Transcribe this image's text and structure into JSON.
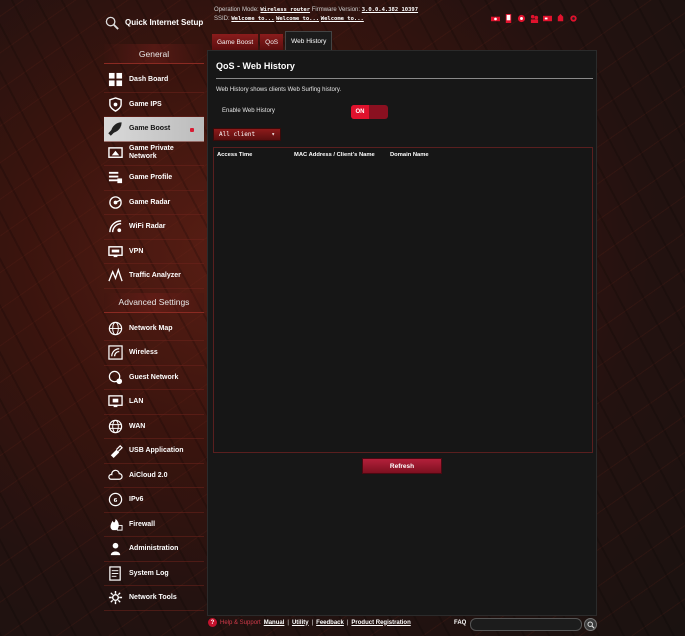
{
  "quick_setup": {
    "label": "Quick Internet Setup",
    "icon": "quick-setup-icon"
  },
  "header": {
    "op_mode_label": "Operation Mode:",
    "op_mode_value": "Wireless router",
    "firmware_label": "Firmware Version:",
    "firmware_value": "3.0.0.4.382_10397",
    "ssid_label": "SSID:",
    "ssid_values": [
      "Welcome to...",
      "Welcome to...",
      "Welcome to..."
    ]
  },
  "status_icons": [
    "network-status-icon",
    "client-icon",
    "usb-icon",
    "users-icon",
    "app-icon",
    "notification-icon",
    "settings-icon"
  ],
  "sidebar": {
    "general_header": "General",
    "general_items": [
      {
        "label": "Dash Board",
        "icon": "dashboard-icon"
      },
      {
        "label": "Game IPS",
        "icon": "shield-icon"
      },
      {
        "label": "Game Boost",
        "icon": "rocket-icon",
        "active": true
      },
      {
        "label": "Game Private Network",
        "icon": "monitor-icon"
      },
      {
        "label": "Game Profile",
        "icon": "profile-icon"
      },
      {
        "label": "Game Radar",
        "icon": "radar-icon"
      },
      {
        "label": "WiFi Radar",
        "icon": "wifi-radar-icon"
      },
      {
        "label": "VPN",
        "icon": "vpn-icon"
      },
      {
        "label": "Traffic Analyzer",
        "icon": "traffic-icon"
      }
    ],
    "advanced_header": "Advanced Settings",
    "advanced_items": [
      {
        "label": "Network Map",
        "icon": "network-map-icon"
      },
      {
        "label": "Wireless",
        "icon": "wireless-icon"
      },
      {
        "label": "Guest Network",
        "icon": "guest-network-icon"
      },
      {
        "label": "LAN",
        "icon": "lan-icon"
      },
      {
        "label": "WAN",
        "icon": "globe-icon"
      },
      {
        "label": "USB Application",
        "icon": "usb-icon"
      },
      {
        "label": "AiCloud 2.0",
        "icon": "cloud-icon"
      },
      {
        "label": "IPv6",
        "icon": "ipv6-icon"
      },
      {
        "label": "Firewall",
        "icon": "firewall-icon"
      },
      {
        "label": "Administration",
        "icon": "admin-icon"
      },
      {
        "label": "System Log",
        "icon": "log-icon"
      },
      {
        "label": "Network Tools",
        "icon": "tools-icon"
      }
    ]
  },
  "tabs": [
    {
      "label": "Game Boost",
      "active": false
    },
    {
      "label": "QoS",
      "active": false
    },
    {
      "label": "Web History",
      "active": true
    }
  ],
  "main": {
    "title": "QoS - Web History",
    "description": "Web History shows clients Web Surfing history.",
    "enable_label": "Enable Web History",
    "toggle_state": "ON",
    "client_select": "All client",
    "table_headers": [
      "Access Time",
      "MAC Address / Client's Name",
      "Domain Name"
    ],
    "refresh_label": "Refresh"
  },
  "footer": {
    "help_label": "Help & Support",
    "links": [
      "Manual",
      "Utility",
      "Feedback",
      "Product Registration"
    ],
    "faq_label": "FAQ"
  },
  "colors": {
    "accent": "#e0122d",
    "active_nav_bg": "#c8c8c8",
    "panel_bg": "#171717"
  }
}
